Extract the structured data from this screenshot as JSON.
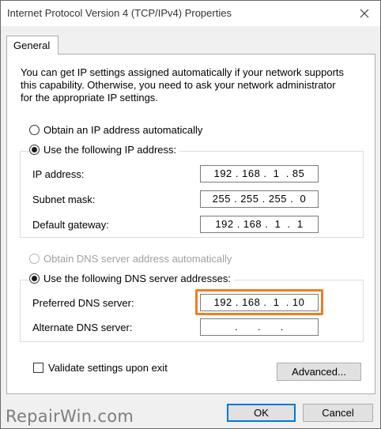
{
  "window": {
    "title": "Internet Protocol Version 4 (TCP/IPv4) Properties",
    "close_icon": "close-icon"
  },
  "tabs": [
    {
      "label": "General",
      "selected": true
    }
  ],
  "intro_text": "You can get IP settings assigned automatically if your network supports\nthis capability. Otherwise, you need to ask your network administrator\nfor the appropriate IP settings.",
  "ip_section": {
    "auto_label": "Obtain an IP address automatically",
    "manual_label": "Use the following IP address:",
    "selected": "manual",
    "fields": [
      {
        "label": "IP address:",
        "value": "192 . 168 .  1  . 85"
      },
      {
        "label": "Subnet mask:",
        "value": "255 . 255 . 255 .  0"
      },
      {
        "label": "Default gateway:",
        "value": "192 . 168 .  1  .  1"
      }
    ]
  },
  "dns_section": {
    "auto_label": "Obtain DNS server address automatically",
    "auto_disabled": true,
    "manual_label": "Use the following DNS server addresses:",
    "selected": "manual",
    "fields": [
      {
        "label": "Preferred DNS server:",
        "value": "192 . 168 .  1  . 10",
        "highlighted": true
      },
      {
        "label": "Alternate DNS server:",
        "value": "  .      .      .  "
      }
    ]
  },
  "validate_label": "Validate settings upon exit",
  "validate_checked": false,
  "buttons": {
    "advanced": "Advanced...",
    "ok": "OK",
    "cancel": "Cancel"
  },
  "watermark": "RepairWin.com",
  "colors": {
    "highlight": "#f47b20",
    "default_button_border": "#0078d7"
  }
}
